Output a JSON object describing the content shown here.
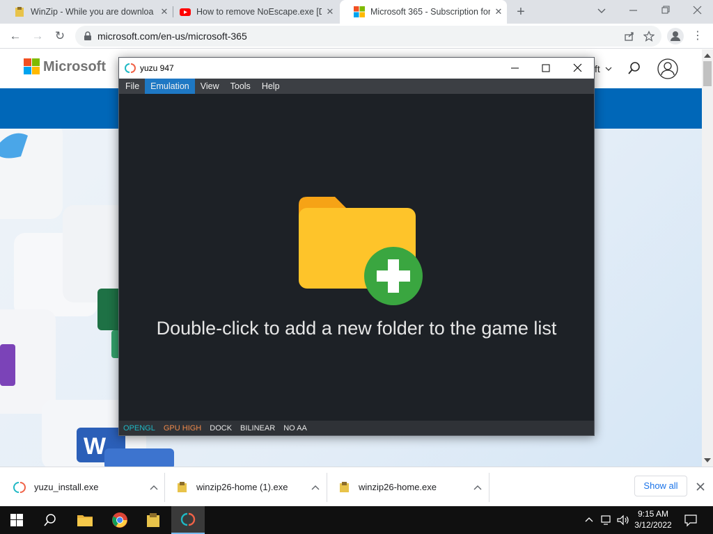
{
  "browser": {
    "tabs": [
      {
        "title": "WinZip - While you are downloa",
        "favicon": "winzip-icon"
      },
      {
        "title": "How to remove NoEscape.exe [D",
        "favicon": "youtube-icon"
      },
      {
        "title": "Microsoft 365 - Subscription for",
        "favicon": "microsoft-icon"
      }
    ],
    "new_tab": "+",
    "url": "microsoft.com/en-us/microsoft-365"
  },
  "page": {
    "brand": "Microsoft",
    "nav_fragment": "ft"
  },
  "yuzu": {
    "title": "yuzu 947",
    "menu": [
      "File",
      "Emulation",
      "View",
      "Tools",
      "Help"
    ],
    "highlighted_menu": "Emulation",
    "empty_message": "Double-click to add a new folder to the game list",
    "status": [
      {
        "label": "OPENGL",
        "color": "#1fb8c4"
      },
      {
        "label": "GPU HIGH",
        "color": "#f08a4b"
      },
      {
        "label": "DOCK",
        "color": "#e8e8e8"
      },
      {
        "label": "BILINEAR",
        "color": "#e8e8e8"
      },
      {
        "label": "NO AA",
        "color": "#e8e8e8"
      }
    ]
  },
  "downloads": {
    "items": [
      {
        "name": "yuzu_install.exe"
      },
      {
        "name": "winzip26-home (1).exe"
      },
      {
        "name": "winzip26-home.exe"
      }
    ],
    "show_all": "Show all"
  },
  "taskbar": {
    "time": "9:15 AM",
    "date": "3/12/2022"
  }
}
